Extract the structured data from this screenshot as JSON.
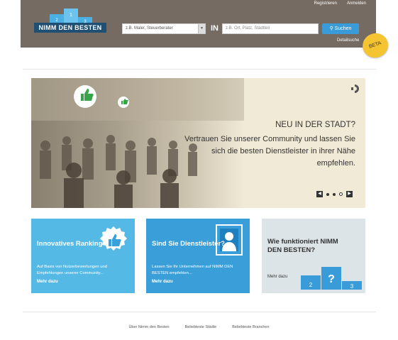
{
  "header": {
    "nav": [
      "Registrieren",
      "Anmelden"
    ],
    "logo_text": "NIMM DEN BESTEN",
    "podium_numbers": [
      "2",
      "1",
      "3"
    ],
    "what_placeholder": "z.B. Maler, Steuerberater",
    "in_label": "IN",
    "where_placeholder": "z.B. Ort, Platz, Stadtteil",
    "search_label": "Suchen",
    "detail_label": "Detailsuche",
    "beta_label": "BETA"
  },
  "hero": {
    "title": "NEU IN DER STADT?",
    "body": "Vertrauen Sie unserer Community und lassen Sie sich die besten Dienstleister in ihrer Nähe empfehlen.",
    "prev_label": "◀",
    "next_label": "▶"
  },
  "tiles": [
    {
      "title": "Innovatives Ranking",
      "desc": "Auf Basis von Nutzerbewertungen und Empfehlungen unserer Community...",
      "more": "Mehr dazu"
    },
    {
      "title": "Sind Sie Dienstleister?",
      "desc": "Lassen Sie Ihr Unternehmen auf NIMM DEN BESTEN empfehlen...",
      "more": "Mehr dazu"
    },
    {
      "title": "Wie funktioniert NIMM DEN BESTEN?",
      "more": "Mehr dazu",
      "podium": [
        "2",
        "?",
        "3"
      ]
    }
  ],
  "footer": [
    "Über Nimm den Besten",
    "Beliebteste Städte",
    "Beliebteste Branchen"
  ],
  "colors": {
    "header": "#756b63",
    "accent": "#3a9bd9",
    "tile1": "#55b9e6",
    "tile2": "#3a9fd9",
    "tile3": "#dde4e8",
    "beta": "#f5c431"
  }
}
